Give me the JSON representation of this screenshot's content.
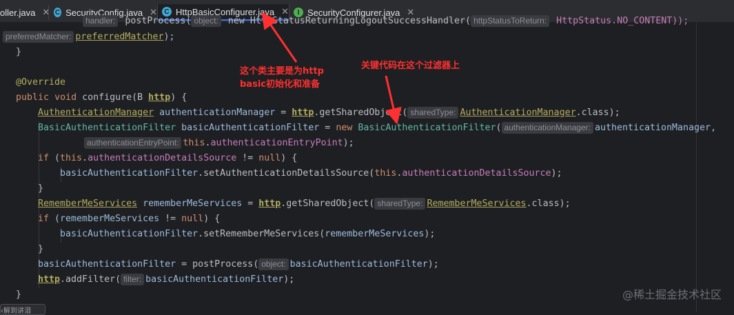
{
  "tabs": [
    {
      "label": "oller.java",
      "icon": "class-icon",
      "active": false
    },
    {
      "label": "SecurityConfig.java",
      "icon": "class-icon",
      "active": false
    },
    {
      "label": "HttpBasicConfigurer.java",
      "icon": "class-icon",
      "active": true
    },
    {
      "label": "SecurityConfigurer.java",
      "icon": "interface-icon",
      "active": false
    }
  ],
  "code": {
    "l0_hint": "handler:",
    "l0_text": " postProcess(",
    "l0_hint2": "object:",
    "l0_text2": " new HttpStatusReturningLogoutSuccessHandler(",
    "l0_hint3": "httpStatusToReturn:",
    "l0_text3": " HttpStatus.NO_CONTENT));",
    "l1_hint": "preferredMatcher:",
    "l1_var": "preferredMatcher",
    "l1_end": ");",
    "l2": "}",
    "l4": "@Override",
    "l5_kw1": "public",
    "l5_kw2": "void",
    "l5_rest": " configure(B ",
    "l5_http": "http",
    "l5_end": ") {",
    "l6_type": "AuthenticationManager",
    "l6_var": "authenticationManager",
    "l6_eq": " = ",
    "l6_http": "http",
    "l6_call": ".getSharedObject(",
    "l6_hint": "sharedType:",
    "l6_cls": "AuthenticationManager",
    "l6_end": ".class);",
    "l7_type": "BasicAuthenticationFilter",
    "l7_var": "basicAuthenticationFilter",
    "l7_eq": " = ",
    "l7_new": "new",
    "l7_cls": "BasicAuthenticationFilter",
    "l7_paren": "(",
    "l7_hint": "authenticationManager:",
    "l7_arg": "authenticationManager,",
    "l8_hint": "authenticationEntryPoint:",
    "l8_this": "this",
    "l8_fld": "authenticationEntryPoint",
    "l8_end": ");",
    "l9_if": "if",
    "l9_open": " (",
    "l9_this": "this",
    "l9_fld": "authenticationDetailsSource",
    "l9_ne": " != ",
    "l9_null": "null",
    "l9_end": ") {",
    "l10_var": "basicAuthenticationFilter",
    "l10_call": ".setAuthenticationDetailsSource(",
    "l10_this": "this",
    "l10_fld": "authenticationDetailsSource",
    "l10_end": ");",
    "l11": "}",
    "l12_type": "RememberMeServices",
    "l12_var": "rememberMeServices",
    "l12_eq": " = ",
    "l12_http": "http",
    "l12_call": ".getSharedObject(",
    "l12_hint": "sharedType:",
    "l12_cls": "RememberMeServices",
    "l12_end": ".class);",
    "l13_if": "if",
    "l13_open": " (",
    "l13_var": "rememberMeServices",
    "l13_ne": " != ",
    "l13_null": "null",
    "l13_end": ") {",
    "l14_var": "basicAuthenticationFilter",
    "l14_call": ".setRememberMeServices(",
    "l14_arg": "rememberMeServices",
    "l14_end": ");",
    "l15": "}",
    "l16_var": "basicAuthenticationFilter",
    "l16_eq": " = postProcess(",
    "l16_hint": "object:",
    "l16_arg": "basicAuthenticationFilter",
    "l16_end": ");",
    "l17_http": "http",
    "l17_call": ".addFilter(",
    "l17_hint": "filter:",
    "l17_arg": "basicAuthenticationFilter",
    "l17_end": ");",
    "l18": "}"
  },
  "annotations": {
    "note1_line1": "这个类主要是为http",
    "note1_line2": "basic初始化和准备",
    "note2": "关键代码在这个过滤器上",
    "color": "#ff3030"
  },
  "watermark": "@稀土掘金技术社区",
  "popup_text": "‹解到讲泪"
}
